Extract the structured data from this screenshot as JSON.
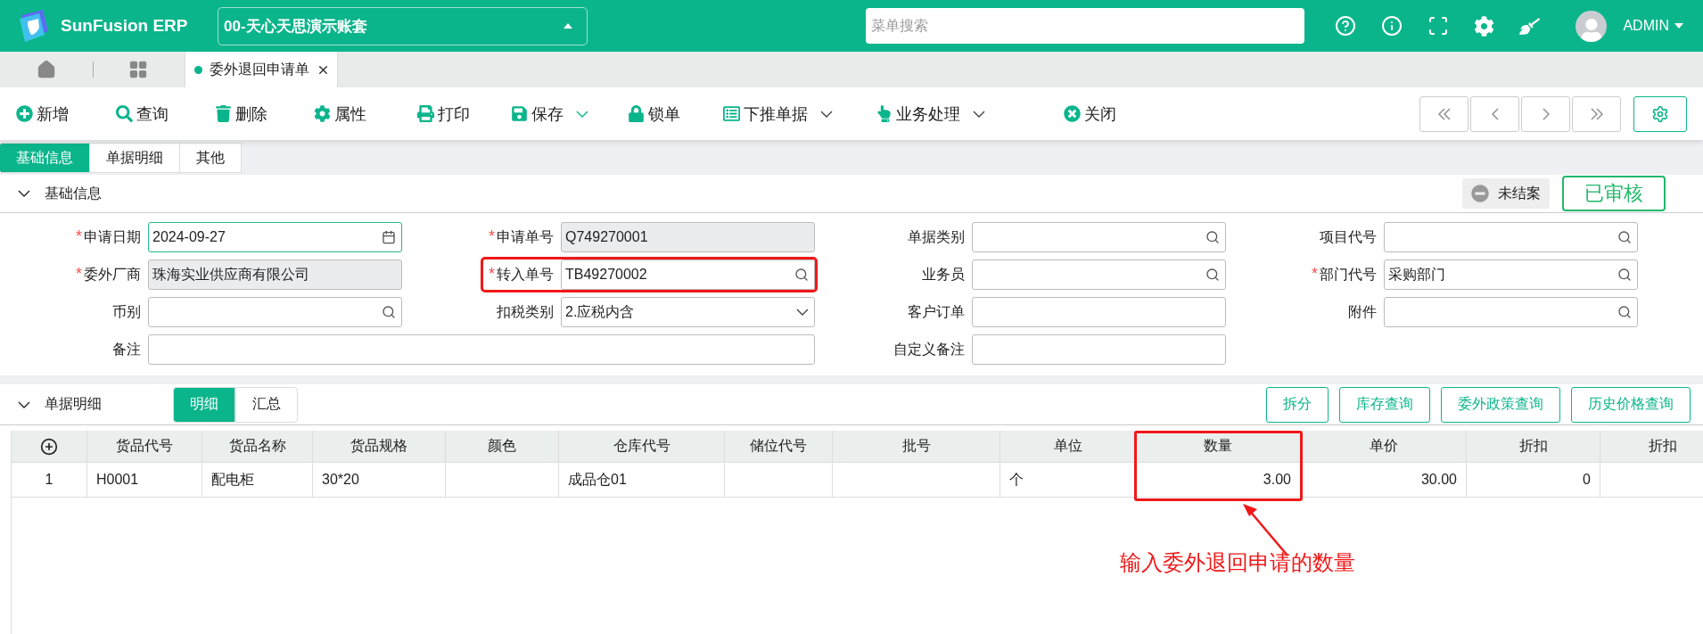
{
  "header": {
    "brand": "SunFusion ERP",
    "account": "00-天心天思演示账套",
    "search": {
      "placeholder": "菜单搜索"
    },
    "user": "ADMIN"
  },
  "page_tabs": [
    {
      "label": "委外退回申请单",
      "selected": true
    }
  ],
  "toolbar": [
    {
      "label": "新增",
      "dropdown": false
    },
    {
      "label": "查询",
      "dropdown": false
    },
    {
      "label": "删除",
      "dropdown": false
    },
    {
      "label": "属性",
      "dropdown": false
    },
    {
      "label": "打印",
      "dropdown": false
    },
    {
      "label": "保存",
      "dropdown": true
    },
    {
      "label": "锁单",
      "dropdown": false
    },
    {
      "label": "下推单据",
      "dropdown": true
    },
    {
      "label": "业务处理",
      "dropdown": true
    },
    {
      "label": "关闭",
      "dropdown": false
    }
  ],
  "form_tabs": [
    {
      "label": "基础信息",
      "selected": true
    },
    {
      "label": "单据明细",
      "selected": false
    },
    {
      "label": "其他",
      "selected": false
    }
  ],
  "basic_section": {
    "title": "基础信息",
    "expanded": true,
    "status": "未结案",
    "stamp": "已审核",
    "fields": [
      {
        "label": "申请日期",
        "value": "2024-09-27",
        "kind": "date",
        "required_mark": "*",
        "disabled": false,
        "focused": true,
        "highlighted": false
      },
      {
        "label": "申请单号",
        "value": "Q749270001",
        "kind": "text",
        "required_mark": "*",
        "disabled": true,
        "focused": false,
        "highlighted": false
      },
      {
        "label": "单据类别",
        "kind": "lookup",
        "disabled": false,
        "focused": false,
        "highlighted": false
      },
      {
        "label": "项目代号",
        "kind": "lookup",
        "disabled": false,
        "focused": false,
        "highlighted": false
      },
      {
        "label": "委外厂商",
        "value": "珠海实业供应商有限公司",
        "kind": "text",
        "required_mark": "*",
        "disabled": true,
        "focused": false,
        "highlighted": false
      },
      {
        "label": "转入单号",
        "value": "TB49270002",
        "kind": "lookup",
        "required_mark": "*",
        "disabled": false,
        "focused": false,
        "highlighted": true
      },
      {
        "label": "业务员",
        "kind": "lookup",
        "disabled": false,
        "focused": false,
        "highlighted": false
      },
      {
        "label": "部门代号",
        "value": "采购部门",
        "kind": "lookup",
        "required_mark": "*",
        "disabled": false,
        "focused": false,
        "highlighted": false
      },
      {
        "label": "币别",
        "kind": "lookup",
        "disabled": false,
        "focused": false,
        "highlighted": false
      },
      {
        "label": "扣税类别",
        "value": "2.应税内含",
        "kind": "select",
        "disabled": false,
        "focused": false,
        "highlighted": false
      },
      {
        "label": "客户订单",
        "kind": "text",
        "disabled": false,
        "focused": false,
        "highlighted": false
      },
      {
        "label": "附件",
        "kind": "lookup",
        "disabled": false,
        "focused": false,
        "highlighted": false
      },
      {
        "label": "备注",
        "kind": "wide_text",
        "disabled": false,
        "focused": false,
        "highlighted": false
      },
      {
        "label": "自定义备注",
        "kind": "text",
        "disabled": false,
        "focused": false,
        "highlighted": false
      }
    ]
  },
  "detail_section": {
    "title": "单据明细",
    "expanded": true,
    "views": [
      {
        "label": "明细",
        "selected": true
      },
      {
        "label": "汇总",
        "selected": false
      }
    ],
    "actions": [
      "拆分",
      "库存查询",
      "委外政策查询",
      "历史价格查询"
    ]
  },
  "table": {
    "columns": [
      {
        "kind": "index"
      },
      {
        "label": "货品代号",
        "kind": "text"
      },
      {
        "label": "货品名称",
        "kind": "text"
      },
      {
        "label": "货品规格",
        "kind": "text"
      },
      {
        "label": "颜色",
        "kind": "text"
      },
      {
        "label": "仓库代号",
        "kind": "text"
      },
      {
        "label": "储位代号",
        "kind": "text"
      },
      {
        "label": "批号",
        "kind": "text"
      },
      {
        "label": "单位",
        "kind": "text"
      },
      {
        "label": "数量",
        "kind": "number",
        "highlighted": true
      },
      {
        "label": "单价",
        "kind": "number"
      },
      {
        "label": "折扣",
        "kind": "number"
      },
      {
        "label": "折扣",
        "kind": "number"
      }
    ],
    "rows": [
      {
        "cells": [
          "1",
          "H0001",
          "配电柜",
          "30*20",
          null,
          "成品仓01",
          null,
          null,
          "个",
          "3.00",
          "30.00",
          "0",
          null
        ]
      }
    ]
  },
  "annotation": {
    "text": "输入委外退回申请的数量"
  }
}
